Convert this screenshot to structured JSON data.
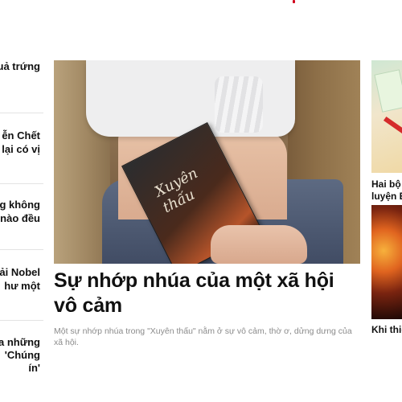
{
  "left_column": {
    "items": [
      {
        "lines": [
          "quả trứng"
        ]
      },
      {
        "lines": [
          "ễn Chết",
          "ng lại có vị"
        ]
      },
      {
        "lines": [
          "ng không",
          "ẹ nào đều"
        ]
      },
      {
        "lines": [
          "Giải Nobel",
          "hư một"
        ]
      },
      {
        "lines": [
          "ủa những",
          "'Chúng",
          "ín'"
        ]
      }
    ]
  },
  "featured": {
    "cover_text": "Xuyên thấu",
    "headline": "Sự nhớp nhúa của một xã hội vô cảm",
    "summary": "Một sự nhớp nhúa trong \"Xuyên thấu\" nằm ở sự vô cảm, thờ ơ, dửng dưng của xã hội."
  },
  "right_column": {
    "items": [
      {
        "title": "Hai bộ",
        "subtitle": "luyện E"
      },
      {
        "title": "Khi thiê"
      }
    ]
  },
  "colors": {
    "accent_dot": "#d0021b",
    "summary_text": "#8b8b8b",
    "headline_text": "#111111"
  }
}
